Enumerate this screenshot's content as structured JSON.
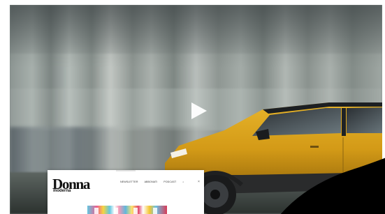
{
  "video": {
    "play_icon": "play-icon",
    "subject": "yellow SUV driving past blurred city street"
  },
  "preview": {
    "logo_main": "Donna",
    "logo_sub": "moderna",
    "nav": [
      "NEWSLETTER",
      "ABBONATI",
      "PODCAST",
      "⌕"
    ],
    "close": "×"
  },
  "colors": {
    "car_body": "#d9a11c",
    "logo": "#111111",
    "blob": "#000000"
  }
}
